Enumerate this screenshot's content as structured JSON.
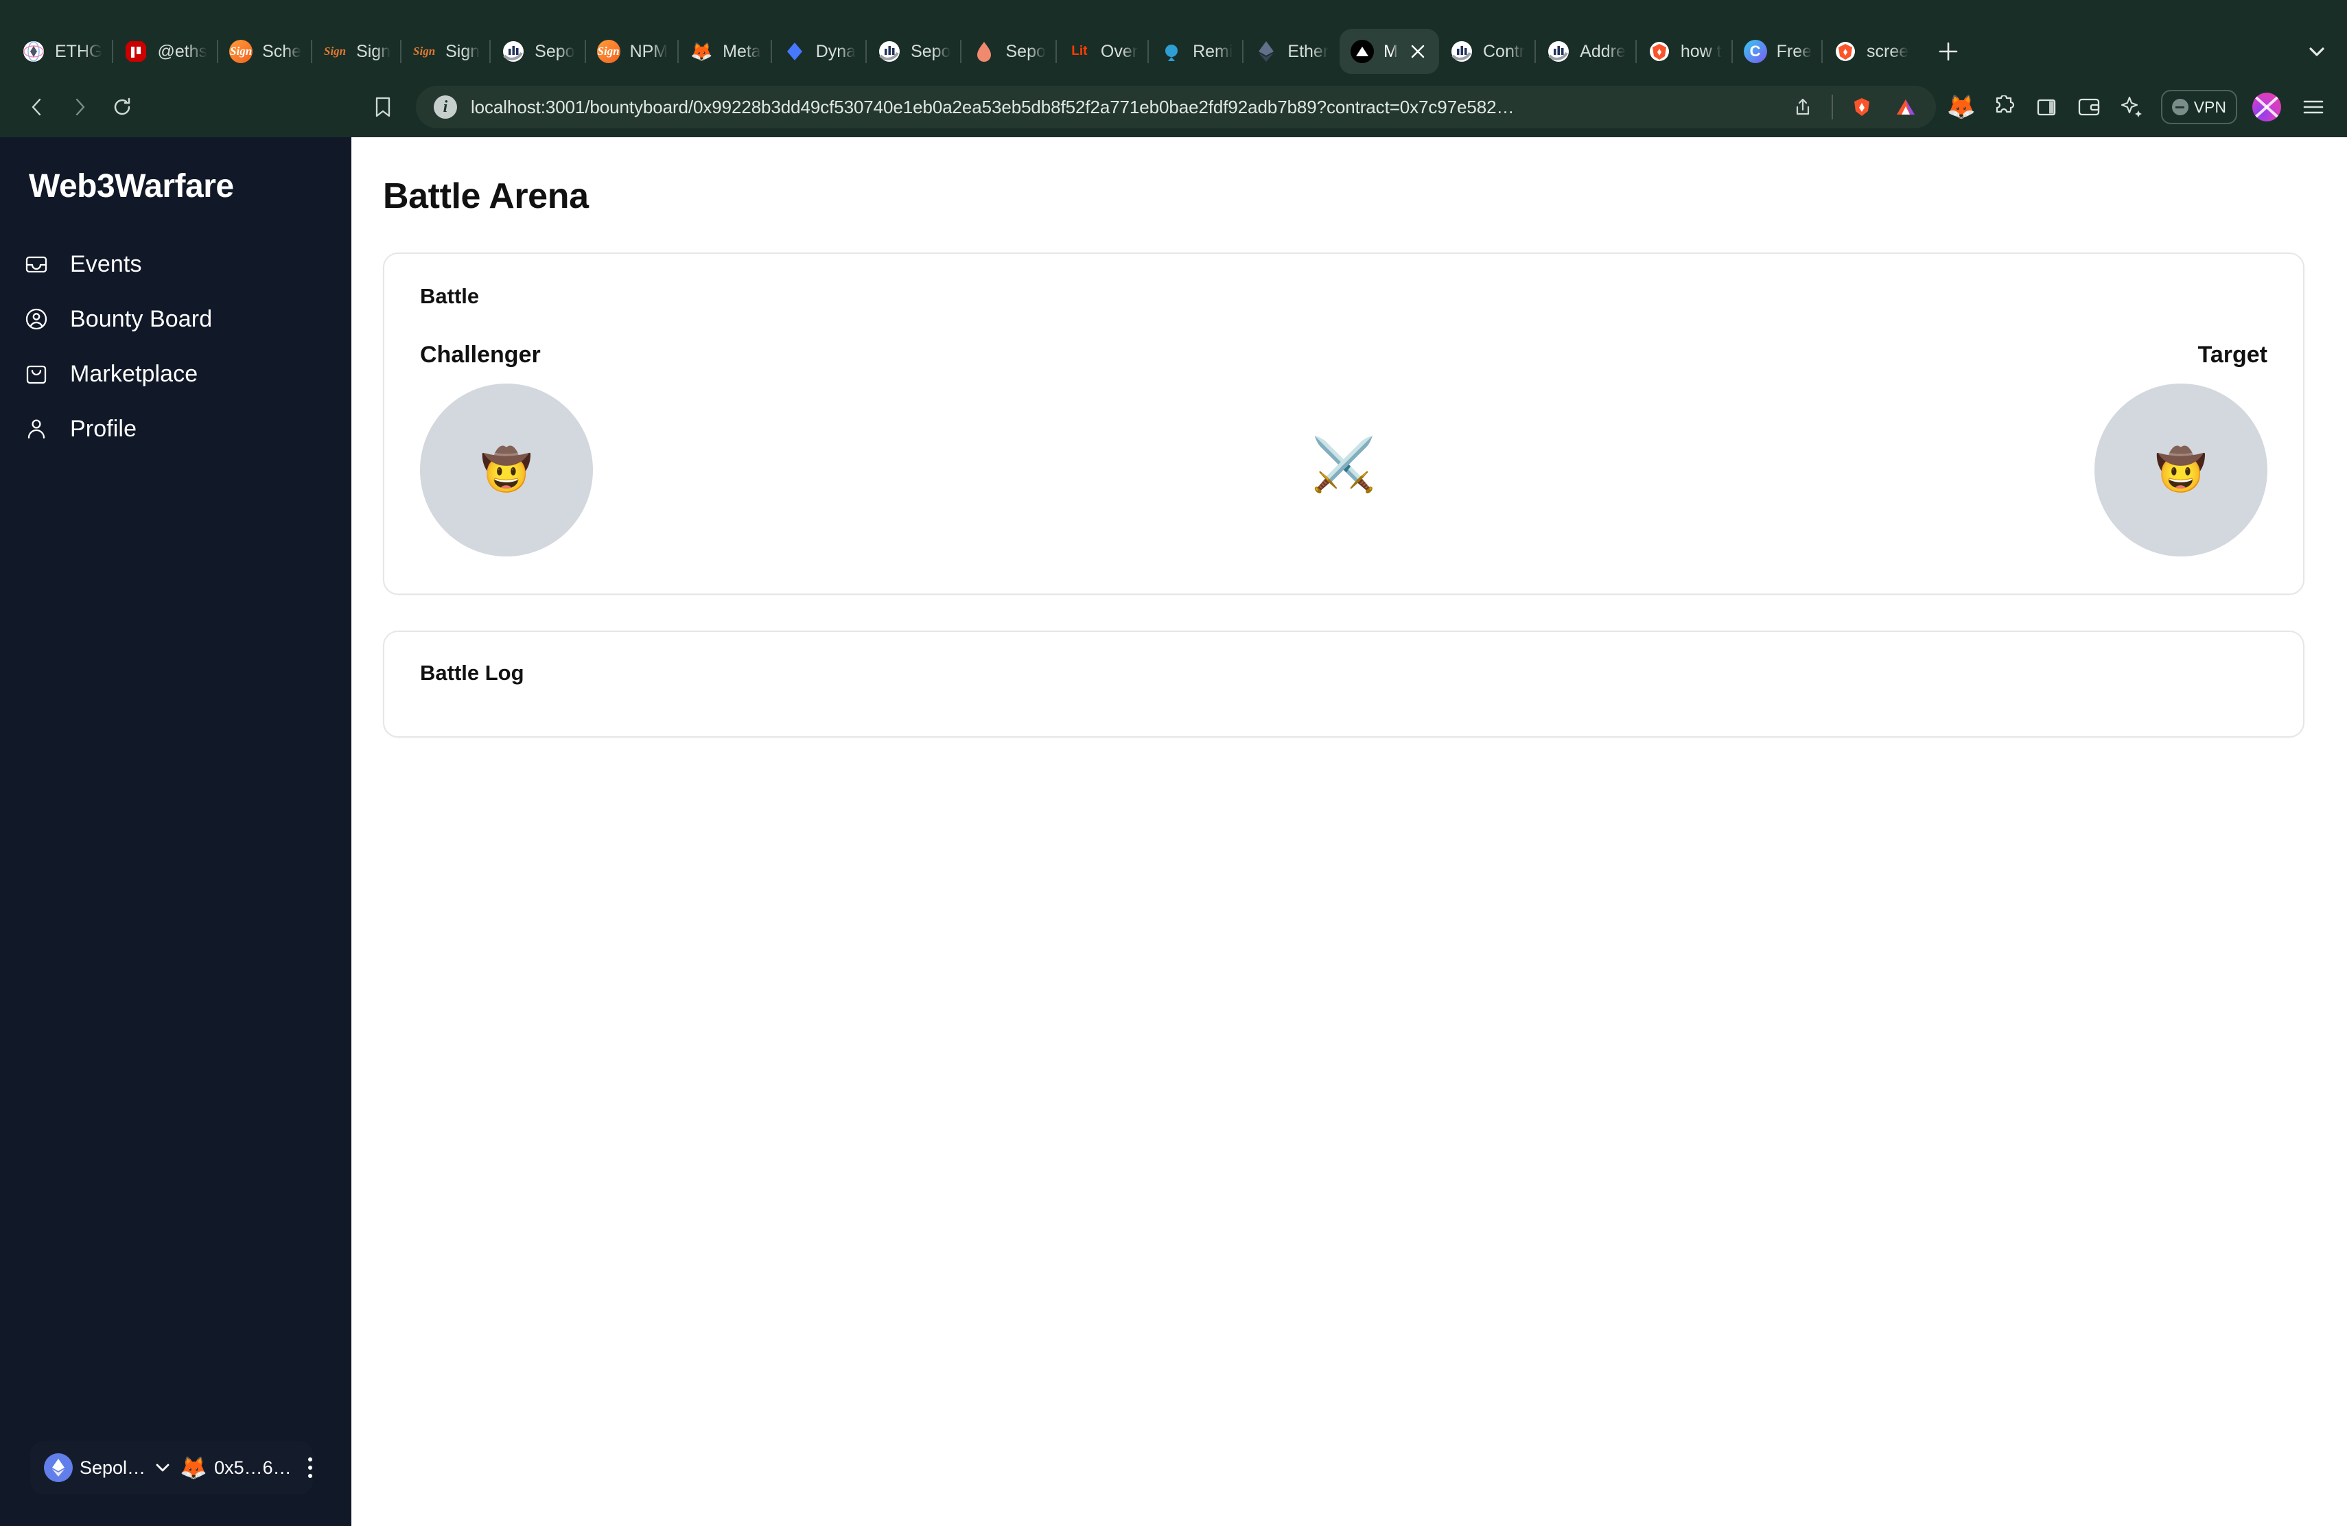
{
  "browser": {
    "tabs": [
      {
        "title": "ETHG",
        "favicon": "ethglobal-icon",
        "active": false
      },
      {
        "title": "@eths",
        "favicon": "npm-icon",
        "active": false
      },
      {
        "title": "Sche",
        "favicon": "sign-icon",
        "active": false
      },
      {
        "title": "Sign",
        "favicon": "sign-script-icon",
        "active": false
      },
      {
        "title": "Sign",
        "favicon": "sign-script-icon",
        "active": false
      },
      {
        "title": "Sepo",
        "favicon": "etherscan-icon",
        "active": false
      },
      {
        "title": "NPM",
        "favicon": "sign-icon",
        "active": false
      },
      {
        "title": "Meta",
        "favicon": "metamask-fox-icon",
        "active": false
      },
      {
        "title": "Dyna",
        "favicon": "dynamic-icon",
        "active": false
      },
      {
        "title": "Sepo",
        "favicon": "etherscan-icon",
        "active": false
      },
      {
        "title": "Sepo",
        "favicon": "flame-icon",
        "active": false
      },
      {
        "title": "Over",
        "favicon": "lit-icon",
        "active": false
      },
      {
        "title": "Remi",
        "favicon": "remix-icon",
        "active": false
      },
      {
        "title": "Ether",
        "favicon": "ethereum-diamond-icon",
        "active": false
      },
      {
        "title": "M",
        "favicon": "vercel-triangle-icon",
        "active": true
      },
      {
        "title": "Contr",
        "favicon": "etherscan-icon",
        "active": false
      },
      {
        "title": "Addre",
        "favicon": "etherscan-icon",
        "active": false
      },
      {
        "title": "how t",
        "favicon": "brave-lion-icon",
        "active": false
      },
      {
        "title": "Free",
        "favicon": "c-circle-icon",
        "active": false
      },
      {
        "title": "scree",
        "favicon": "brave-lion-icon",
        "active": false
      }
    ],
    "new_tab_label": "+",
    "url": "localhost:3001/bountyboard/0x99228b3dd49cf530740e1eb0a2ea53eb5db8f52f2a771eb0bae2fdf92adb7b89?contract=0x7c97e582…",
    "vpn_label": "VPN",
    "toolbar_icons": [
      "metamask-fox-icon",
      "extensions-puzzle-icon",
      "sidebar-panel-icon",
      "wallet-icon",
      "leo-ai-sparkle-icon"
    ],
    "omnibox_icons": [
      "info-circle-icon",
      "share-icon",
      "brave-shield-icon",
      "brave-rewards-icon"
    ],
    "nav_icons": [
      "back-arrow-icon",
      "forward-arrow-icon",
      "reload-icon",
      "bookmark-icon"
    ]
  },
  "sidebar": {
    "brand": "Web3Warfare",
    "items": [
      {
        "label": "Events",
        "icon": "inbox-icon"
      },
      {
        "label": "Bounty Board",
        "icon": "user-circle-icon"
      },
      {
        "label": "Marketplace",
        "icon": "shopping-bag-icon"
      },
      {
        "label": "Profile",
        "icon": "person-icon"
      }
    ],
    "wallet": {
      "network": "Sepol…",
      "network_icon": "ethereum-diamond-icon",
      "account": "0x5…6…",
      "account_icon": "metamask-fox-icon",
      "menu_icon": "kebab-menu-icon"
    }
  },
  "main": {
    "page_title": "Battle Arena",
    "battle_card": {
      "label": "Battle",
      "challenger_label": "Challenger",
      "challenger_avatar": "🤠",
      "target_label": "Target",
      "target_avatar": "🤠",
      "vs_icon": "⚔️"
    },
    "battle_log_card": {
      "label": "Battle Log",
      "entries": []
    }
  },
  "colors": {
    "sidebar_bg": "#111827",
    "browser_chrome": "#1a2e28",
    "page_bg": "#ffffff",
    "card_border": "#e6e6e6",
    "avatar_bg": "#d3d7de",
    "wallet_bg": "#141c2b"
  }
}
